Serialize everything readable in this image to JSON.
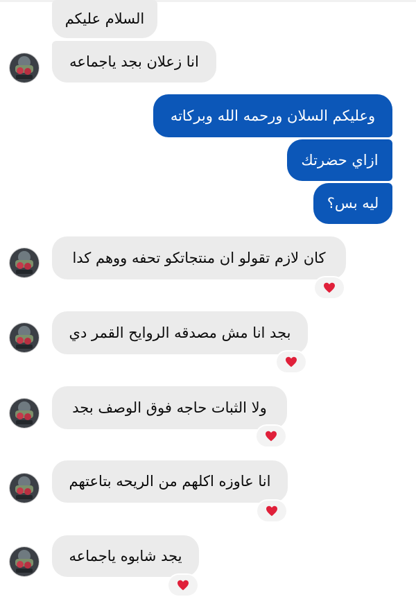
{
  "messages": [
    {
      "side": "in",
      "text": "السلام عليكم"
    },
    {
      "side": "in",
      "text": "انا زعلان بجد ياجماعه"
    },
    {
      "side": "out",
      "text": "وعليكم السلان ورحمه الله وبركاته"
    },
    {
      "side": "out",
      "text": "ازاي حضرتك"
    },
    {
      "side": "out",
      "text": "ليه بس؟"
    },
    {
      "side": "in",
      "text": "كان لازم تقولو ان منتجاتكو تحفه ووهم كدا",
      "reaction": "heart"
    },
    {
      "side": "in",
      "text": "بجد انا مش مصدقه الروايح القمر دي",
      "reaction": "heart"
    },
    {
      "side": "in",
      "text": "ولا الثبات حاجه فوق الوصف بجد",
      "reaction": "heart"
    },
    {
      "side": "in",
      "text": "انا عاوزه اكلهم من الريحه بتاعتهم",
      "reaction": "heart"
    },
    {
      "side": "in",
      "text": "يجد شابوه ياجماعه",
      "reaction": "heart"
    }
  ],
  "colors": {
    "incoming_bubble": "#ebebeb",
    "outgoing_bubble": "#0c57b8",
    "reaction_heart": "#e0203a"
  }
}
